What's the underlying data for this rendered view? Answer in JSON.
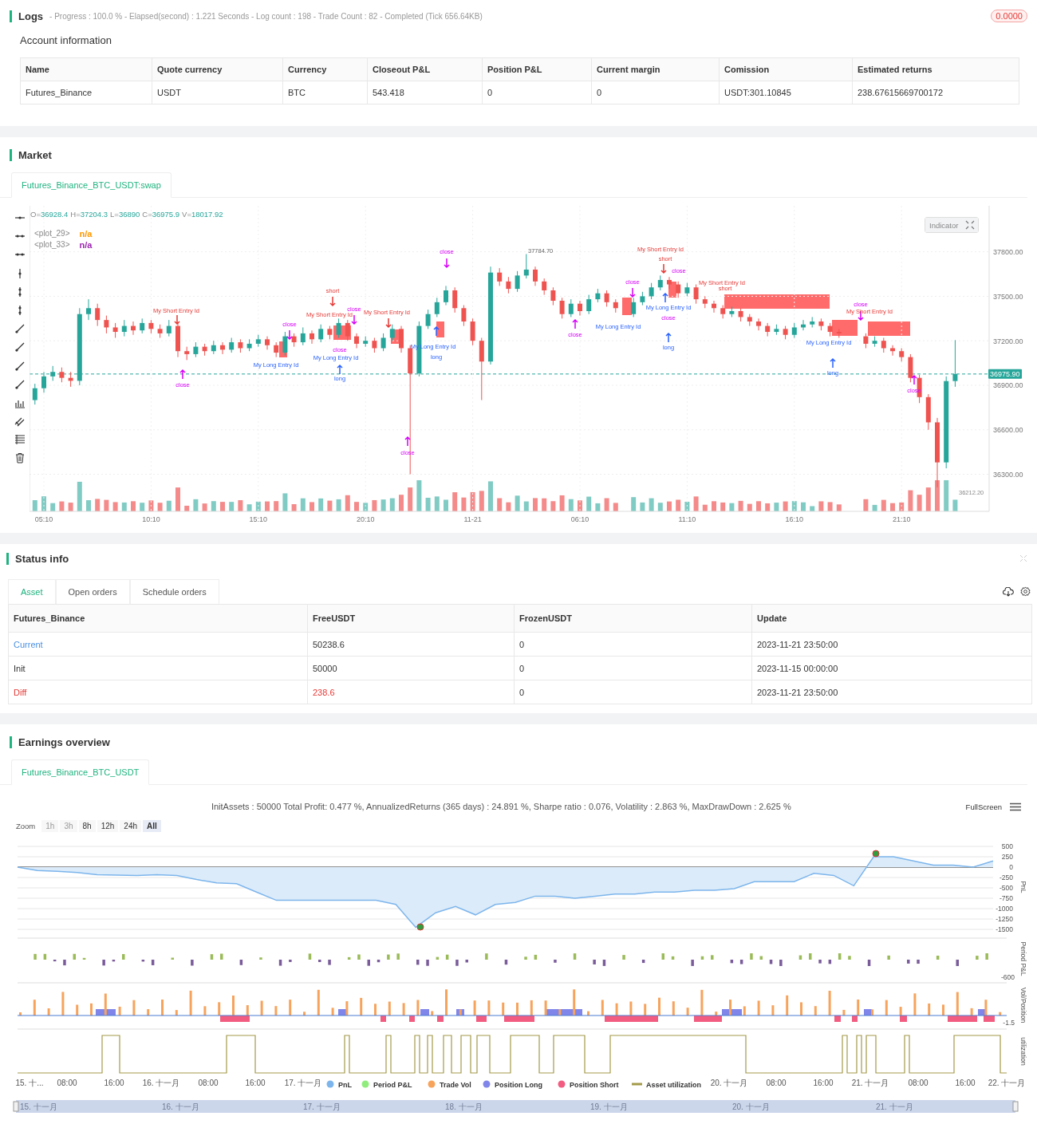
{
  "logs": {
    "title": "Logs",
    "summary": "- Progress : 100.0 % - Elapsed(second) : 1.221  Seconds - Log count : 198 - Trade Count : 82 - Completed (Tick 656.64KB)",
    "badge": "0.0000"
  },
  "account": {
    "title": "Account information",
    "columns": [
      "Name",
      "Quote currency",
      "Currency",
      "Closeout P&L",
      "Position P&L",
      "Current margin",
      "Comission",
      "Estimated returns"
    ],
    "rows": [
      [
        "Futures_Binance",
        "USDT",
        "BTC",
        "543.418",
        "0",
        "0",
        "USDT:301.10845",
        "238.67615669700172"
      ]
    ]
  },
  "market": {
    "title": "Market",
    "tabs": [
      {
        "label": "Futures_Binance_BTC_USDT:swap",
        "selected": true
      }
    ],
    "ohlc": [
      {
        "key": "O=",
        "value": "36928.4"
      },
      {
        "key": "H=",
        "value": "37204.3"
      },
      {
        "key": "L=",
        "value": "36890"
      },
      {
        "key": "C=",
        "value": "36975.9"
      },
      {
        "key": "V=",
        "value": "18017.92"
      }
    ],
    "plots": [
      {
        "name": "<plot_29>",
        "value": "n/a",
        "color": "#ff9800"
      },
      {
        "name": "<plot_33>",
        "value": "n/a",
        "color": "#9c27b0"
      }
    ],
    "indicator_button": "Indicator",
    "time_ticks": [
      "05:10",
      "10:10",
      "15:10",
      "20:10",
      "11-21",
      "06:10",
      "11:10",
      "16:10",
      "21:10"
    ],
    "last_price": "36975.90",
    "high_note": "37784.70",
    "low_note": "36212.20",
    "chart_data": {
      "type": "candlestick",
      "grid": true,
      "ylim": [
        36050,
        38110
      ],
      "yticks": [
        {
          "value": 37800,
          "label": "37800.00"
        },
        {
          "value": 37500,
          "label": "37500.00"
        },
        {
          "value": 37200,
          "label": "37200.00"
        },
        {
          "value": 36900,
          "label": "36900.00"
        },
        {
          "value": 36600,
          "label": "36600.00"
        },
        {
          "value": 36300,
          "label": "36300.00"
        }
      ],
      "ohlc": [
        [
          36800,
          36910,
          36770,
          36880
        ],
        [
          36880,
          36990,
          36850,
          36960
        ],
        [
          36960,
          37030,
          36930,
          36990
        ],
        [
          36990,
          37020,
          36920,
          36950
        ],
        [
          36950,
          36990,
          36890,
          36930
        ],
        [
          36930,
          37420,
          36900,
          37380
        ],
        [
          37380,
          37480,
          37340,
          37420
        ],
        [
          37420,
          37450,
          37300,
          37340
        ],
        [
          37340,
          37370,
          37250,
          37290
        ],
        [
          37290,
          37320,
          37220,
          37260
        ],
        [
          37260,
          37340,
          37230,
          37300
        ],
        [
          37300,
          37330,
          37240,
          37270
        ],
        [
          37270,
          37350,
          37250,
          37320
        ],
        [
          37320,
          37340,
          37250,
          37280
        ],
        [
          37280,
          37310,
          37220,
          37250
        ],
        [
          37250,
          37340,
          37230,
          37300
        ],
        [
          37300,
          37320,
          37090,
          37130
        ],
        [
          37130,
          37160,
          37070,
          37110
        ],
        [
          37110,
          37190,
          37090,
          37160
        ],
        [
          37160,
          37180,
          37100,
          37130
        ],
        [
          37130,
          37200,
          37110,
          37170
        ],
        [
          37170,
          37190,
          37110,
          37140
        ],
        [
          37140,
          37220,
          37120,
          37190
        ],
        [
          37190,
          37210,
          37120,
          37150
        ],
        [
          37150,
          37210,
          37130,
          37180
        ],
        [
          37180,
          37240,
          37160,
          37210
        ],
        [
          37210,
          37230,
          37140,
          37170
        ],
        [
          37170,
          37190,
          37090,
          37120
        ],
        [
          37120,
          37260,
          37100,
          37230
        ],
        [
          37230,
          37250,
          37160,
          37190
        ],
        [
          37190,
          37290,
          37170,
          37250
        ],
        [
          37250,
          37270,
          37180,
          37210
        ],
        [
          37210,
          37310,
          37190,
          37280
        ],
        [
          37280,
          37300,
          37210,
          37240
        ],
        [
          37240,
          37350,
          37220,
          37320
        ],
        [
          37320,
          37340,
          37200,
          37230
        ],
        [
          37230,
          37250,
          37150,
          37180
        ],
        [
          37180,
          37230,
          37160,
          37200
        ],
        [
          37200,
          37220,
          37120,
          37150
        ],
        [
          37150,
          37250,
          37130,
          37220
        ],
        [
          37220,
          37310,
          37200,
          37280
        ],
        [
          37280,
          37300,
          37120,
          37150
        ],
        [
          37150,
          37170,
          36300,
          36980
        ],
        [
          36980,
          37330,
          36960,
          37300
        ],
        [
          37300,
          37410,
          37280,
          37380
        ],
        [
          37380,
          37490,
          37360,
          37460
        ],
        [
          37460,
          37570,
          37440,
          37540
        ],
        [
          37540,
          37560,
          37390,
          37420
        ],
        [
          37420,
          37440,
          37300,
          37330
        ],
        [
          37330,
          37350,
          37170,
          37200
        ],
        [
          37200,
          37220,
          36800,
          37060
        ],
        [
          37060,
          37700,
          37040,
          37660
        ],
        [
          37660,
          37690,
          37570,
          37600
        ],
        [
          37600,
          37630,
          37520,
          37550
        ],
        [
          37550,
          37670,
          37530,
          37640
        ],
        [
          37640,
          37784.7,
          37620,
          37680
        ],
        [
          37680,
          37700,
          37570,
          37600
        ],
        [
          37600,
          37620,
          37510,
          37540
        ],
        [
          37540,
          37560,
          37440,
          37470
        ],
        [
          37470,
          37490,
          37350,
          37380
        ],
        [
          37380,
          37480,
          37360,
          37450
        ],
        [
          37450,
          37470,
          37370,
          37400
        ],
        [
          37400,
          37510,
          37380,
          37480
        ],
        [
          37480,
          37550,
          37460,
          37520
        ],
        [
          37520,
          37540,
          37430,
          37460
        ],
        [
          37460,
          37480,
          37390,
          37420
        ],
        null,
        [
          37380,
          37490,
          37360,
          37460
        ],
        [
          37460,
          37530,
          37440,
          37500
        ],
        [
          37500,
          37590,
          37480,
          37560
        ],
        [
          37560,
          37640,
          37540,
          37610
        ],
        [
          37610,
          37630,
          37550,
          37580
        ],
        [
          37580,
          37600,
          37490,
          37520
        ],
        [
          37520,
          37590,
          37500,
          37560
        ],
        [
          37560,
          37580,
          37450,
          37480
        ],
        [
          37480,
          37500,
          37420,
          37450
        ],
        [
          37450,
          37470,
          37390,
          37420
        ],
        [
          37420,
          37440,
          37350,
          37380
        ],
        [
          37380,
          37430,
          37360,
          37400
        ],
        [
          37400,
          37420,
          37330,
          37360
        ],
        [
          37360,
          37380,
          37300,
          37330
        ],
        [
          37330,
          37350,
          37270,
          37300
        ],
        [
          37300,
          37320,
          37230,
          37260
        ],
        [
          37260,
          37310,
          37240,
          37280
        ],
        [
          37280,
          37300,
          37210,
          37240
        ],
        [
          37240,
          37320,
          37220,
          37290
        ],
        [
          37290,
          37340,
          37270,
          37310
        ],
        [
          37310,
          37360,
          37290,
          37330
        ],
        [
          37330,
          37350,
          37270,
          37300
        ],
        [
          37300,
          37320,
          37230,
          37260
        ],
        [
          37260,
          37280,
          37220,
          37250
        ],
        null,
        null,
        [
          37230,
          37250,
          37150,
          37180
        ],
        [
          37180,
          37230,
          37160,
          37200
        ],
        [
          37200,
          37220,
          37120,
          37150
        ],
        [
          37150,
          37170,
          37100,
          37130
        ],
        [
          37130,
          37150,
          37060,
          37090
        ],
        [
          37090,
          37110,
          36920,
          36950
        ],
        [
          36950,
          36970,
          36780,
          36820
        ],
        [
          36820,
          36840,
          36600,
          36650
        ],
        [
          36650,
          36680,
          36212.2,
          36380
        ],
        [
          36380,
          36960,
          36340,
          36928.4
        ],
        [
          36928.4,
          37204.3,
          36890,
          36975.9
        ]
      ]
    },
    "trade_marks": [
      {
        "kind": "close",
        "label": "close"
      },
      {
        "kind": "short_entry",
        "label": "My Short Entry Id"
      },
      {
        "kind": "short",
        "label": "short"
      },
      {
        "kind": "close",
        "label": "close"
      },
      {
        "kind": "close",
        "label": "close"
      },
      {
        "kind": "short_entry",
        "label": "My Short Entry Id"
      },
      {
        "kind": "short",
        "label": "short"
      },
      {
        "kind": "short",
        "label": "short"
      },
      {
        "kind": "long_entry",
        "label": "My Long Entry Id"
      },
      {
        "kind": "close",
        "label": "close"
      },
      {
        "kind": "close",
        "label": "close"
      },
      {
        "kind": "short_entry",
        "label": "My Short Entry Id"
      },
      {
        "kind": "short_entry",
        "label": "My Short Entry Id"
      },
      {
        "kind": "short_entry",
        "label": "My Short Entry Id"
      },
      {
        "kind": "short_entry",
        "label": "My Short Entry Id"
      },
      {
        "kind": "close",
        "label": "close"
      },
      {
        "kind": "close",
        "label": "close"
      },
      {
        "kind": "close",
        "label": "close"
      },
      {
        "kind": "long_entry",
        "label": "My Long Entry Id"
      },
      {
        "kind": "long",
        "label": "long"
      },
      {
        "kind": "long",
        "label": "long"
      },
      {
        "kind": "long_entry",
        "label": "My Long Entry Id"
      },
      {
        "kind": "long_entry",
        "label": "My Long Entry Id"
      },
      {
        "kind": "close",
        "label": "close"
      },
      {
        "kind": "long_entry",
        "label": "My Long Entry Id"
      },
      {
        "kind": "long",
        "label": "long"
      },
      {
        "kind": "long_entry",
        "label": "My Long Entry Id"
      },
      {
        "kind": "long",
        "label": "long"
      },
      {
        "kind": "close",
        "label": "close"
      },
      {
        "kind": "close",
        "label": "close"
      },
      {
        "kind": "close",
        "label": "close"
      }
    ]
  },
  "status": {
    "title": "Status info",
    "tabs": [
      {
        "label": "Asset",
        "selected": true
      },
      {
        "label": "Open orders",
        "selected": false
      },
      {
        "label": "Schedule orders",
        "selected": false
      }
    ],
    "columns": [
      "Futures_Binance",
      "FreeUSDT",
      "FrozenUSDT",
      "Update"
    ],
    "rows": [
      {
        "kind": "current",
        "cells": [
          "Current",
          "50238.6",
          "0",
          "2023-11-21 23:50:00"
        ]
      },
      {
        "kind": "init",
        "cells": [
          "Init",
          "50000",
          "0",
          "2023-11-15 00:00:00"
        ]
      },
      {
        "kind": "diff",
        "cells": [
          "Diff",
          "238.6",
          "0",
          "2023-11-21 23:50:00"
        ]
      }
    ]
  },
  "earnings": {
    "title": "Earnings overview",
    "tabs": [
      {
        "label": "Futures_Binance_BTC_USDT",
        "selected": true
      }
    ],
    "stats": "InitAssets : 50000 Total Profit: 0.477 %, AnnualizedReturns (365 days) : 24.891 %, Sharpe ratio : 0.076, Volatility : 2.863 %, MaxDrawDown : 2.625 %",
    "fullscreen": "FullScreen",
    "zoom_label": "Zoom",
    "zoom_buttons": [
      {
        "label": "1h",
        "selected": false,
        "disabled": true
      },
      {
        "label": "3h",
        "selected": false,
        "disabled": true
      },
      {
        "label": "8h",
        "selected": false,
        "disabled": false
      },
      {
        "label": "12h",
        "selected": false,
        "disabled": false
      },
      {
        "label": "24h",
        "selected": false,
        "disabled": false
      },
      {
        "label": "All",
        "selected": true,
        "disabled": false
      }
    ],
    "chart_data": {
      "type": "area",
      "grid": true,
      "ylabel": "PnL",
      "ylim": [
        -1500,
        500
      ],
      "yticks": [
        500,
        250,
        0,
        -250,
        -500,
        -750,
        -1000,
        -1250,
        -1500
      ],
      "series": [
        {
          "name": "PnL",
          "color": "#7cb5ec",
          "values": [
            0,
            -80,
            -100,
            -130,
            -180,
            -190,
            -200,
            -180,
            -200,
            -300,
            -380,
            -400,
            -600,
            -800,
            -800,
            -800,
            -800,
            -800,
            -800,
            -900,
            -1450,
            -1100,
            -950,
            -1150,
            -900,
            -850,
            -700,
            -700,
            -750,
            -700,
            -650,
            -650,
            -600,
            -600,
            -560,
            -560,
            -520,
            -350,
            -350,
            -350,
            -150,
            -200,
            -450,
            250,
            250,
            150,
            50,
            50,
            0,
            150
          ]
        }
      ]
    },
    "panel_labels": [
      "Period P&L",
      "Vol/Position",
      "utilization"
    ],
    "panel_ticks": [
      "-600",
      "-1.5"
    ],
    "x_labels": [
      "15. 十...",
      "08:00",
      "16:00",
      "16. 十一月",
      "08:00",
      "16:00",
      "17. 十一月",
      "20. 十一月",
      "08:00",
      "16:00",
      "21. 十一月",
      "08:00",
      "16:00",
      "22. 十一月"
    ],
    "legend": [
      {
        "label": "Period P&L",
        "color": "#90ed7d",
        "kind": "dot"
      },
      {
        "label": "Trade Vol",
        "color": "#f7a35c",
        "kind": "dot"
      },
      {
        "label": "Position Long",
        "color": "#8085e9",
        "kind": "dot"
      },
      {
        "label": "Position Short",
        "color": "#f15c80",
        "kind": "dot"
      },
      {
        "label": "Asset utilization",
        "color": "#a39a4a",
        "kind": "line"
      }
    ],
    "navigator_labels": [
      "15. 十一月",
      "16. 十一月",
      "17. 十一月",
      "18. 十一月",
      "19. 十一月",
      "20. 十一月",
      "21. 十一月"
    ]
  }
}
